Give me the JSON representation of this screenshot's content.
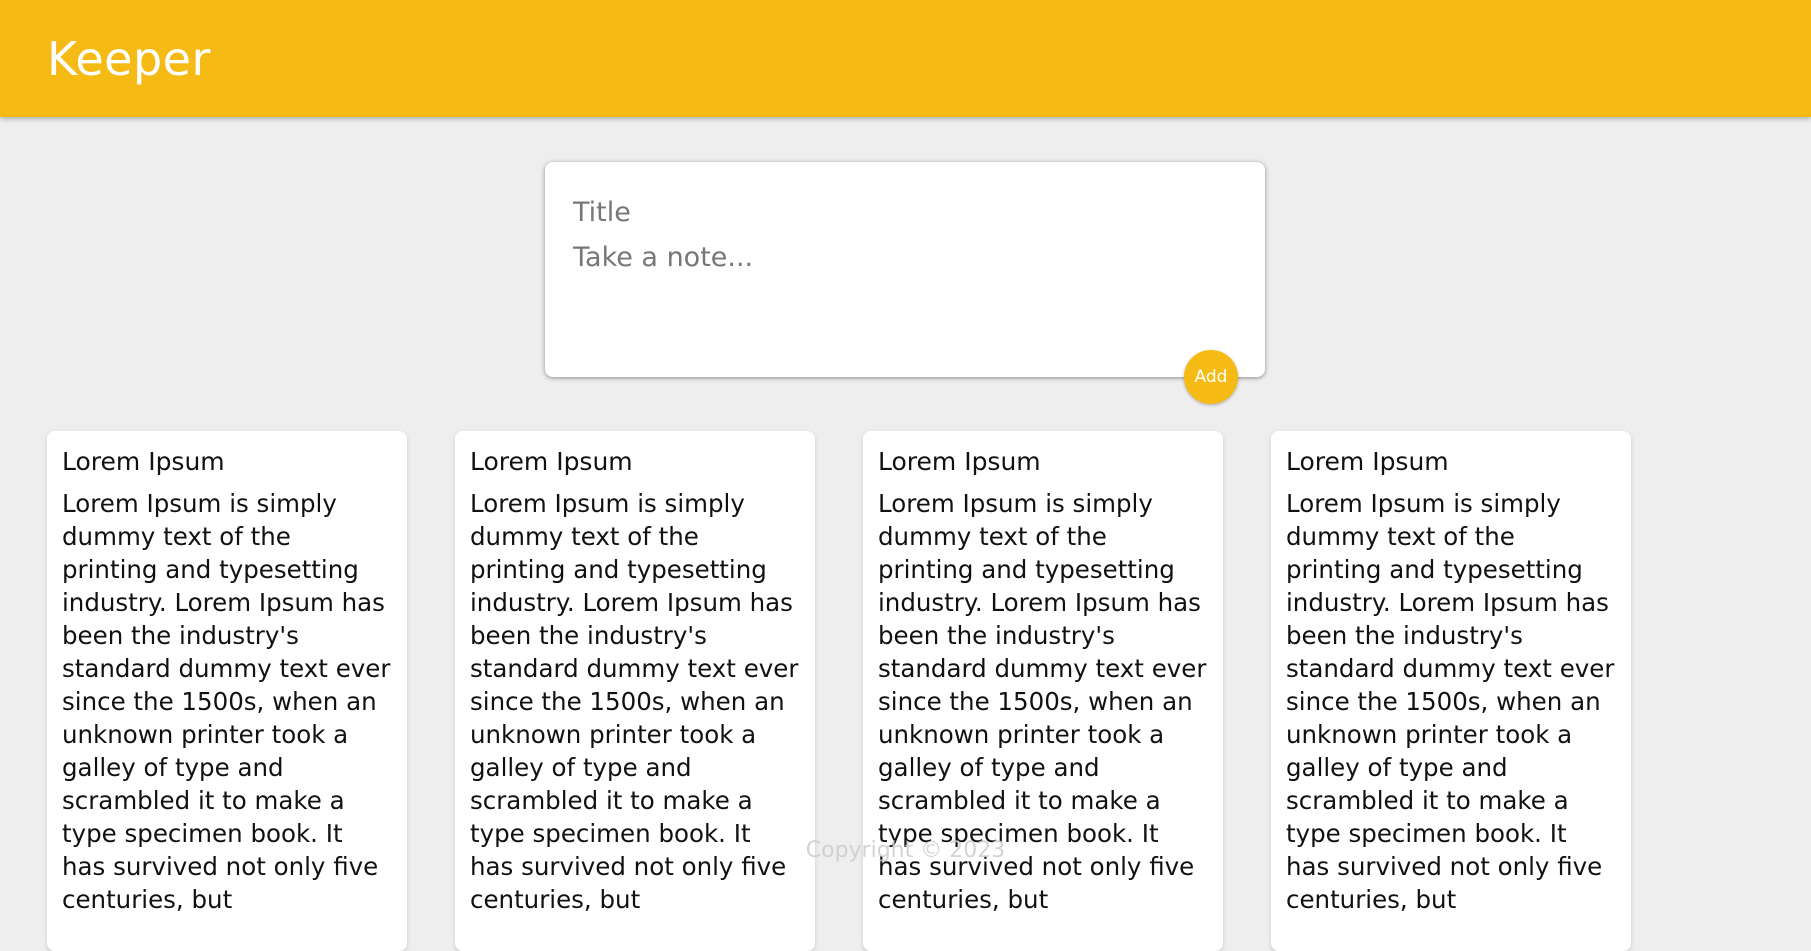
{
  "header": {
    "brand": "Keeper"
  },
  "create_area": {
    "title_placeholder": "Title",
    "content_placeholder": "Take a note...",
    "add_label": "Add"
  },
  "notes": [
    {
      "title": "Lorem Ipsum",
      "content": "Lorem Ipsum is simply dummy text of the printing and typesetting industry. Lorem Ipsum has been the industry's standard dummy text ever since the 1500s, when an unknown printer took a galley of type and scrambled it to make a type specimen book. It has survived not only five centuries, but"
    },
    {
      "title": "Lorem Ipsum",
      "content": "Lorem Ipsum is simply dummy text of the printing and typesetting industry. Lorem Ipsum has been the industry's standard dummy text ever since the 1500s, when an unknown printer took a galley of type and scrambled it to make a type specimen book. It has survived not only five centuries, but"
    },
    {
      "title": "Lorem Ipsum",
      "content": "Lorem Ipsum is simply dummy text of the printing and typesetting industry. Lorem Ipsum has been the industry's standard dummy text ever since the 1500s, when an unknown printer took a galley of type and scrambled it to make a type specimen book. It has survived not only five centuries, but"
    },
    {
      "title": "Lorem Ipsum",
      "content": "Lorem Ipsum is simply dummy text of the printing and typesetting industry. Lorem Ipsum has been the industry's standard dummy text ever since the 1500s, when an unknown printer took a galley of type and scrambled it to make a type specimen book. It has survived not only five centuries, but"
    }
  ],
  "footer": {
    "copyright": "Copyright © 2023"
  },
  "colors": {
    "accent": "#f5ba13",
    "background": "#eeeeee",
    "card": "#ffffff",
    "footer_text": "#cccccc"
  }
}
